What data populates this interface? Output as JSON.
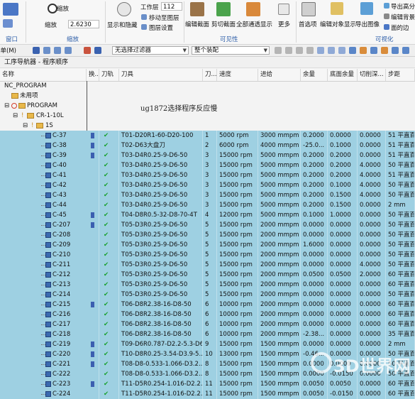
{
  "ribbon": {
    "zoom_label": "缩放",
    "zoom_field_label": "缩放",
    "zoom_value": "2.6230",
    "layer_label": "工作层",
    "layer_value": "112",
    "show_hide": "显示和隐藏",
    "move_to_layer": "移动至图层",
    "layer_settings": "图层设置",
    "edit_section": "编辑截面",
    "cut_section": "剪切截面",
    "show_all": "全部通透显示",
    "more": "更多",
    "preferences": "首选项",
    "edit_object_display": "编辑对象显示",
    "export_image": "导出图像",
    "export_hd": "导出高分",
    "edit_background": "编辑背景",
    "face_edges": "面的边",
    "group_window": "窗口",
    "group_zoom": "缩放",
    "group_visibility": "可见性",
    "group_visualize": "可视化"
  },
  "toolbar": {
    "menu_label": "菜单(M)",
    "filter": "无选择过滤器",
    "assembly": "整个装配"
  },
  "navigator": {
    "title": "工序导航器 - 程序顺序"
  },
  "columns": [
    "名称",
    "换...",
    "刀轨",
    "刀具",
    "刀...",
    "速度",
    "进给",
    "余量",
    "底面余量",
    "切削深...",
    "步距"
  ],
  "tree": {
    "root": "NC_PROGRAM",
    "unused": "未用项",
    "program": "PROGRAM",
    "group": "CR-1-10L",
    "sub": "1S"
  },
  "annotation": "ug1872选择程序反应慢",
  "rows": [
    {
      "name": "C-37",
      "tool": "T01-D20R1-60-D20-100",
      "num": "1",
      "speed": "5000 rpm",
      "feed": "3000 mmpm",
      "stock": "0.2000",
      "floor": "0.0000",
      "depth": "0.0000",
      "step": "51 平直百",
      "gear": true
    },
    {
      "name": "C-38",
      "tool": "T02-D63大盘刀",
      "num": "2",
      "speed": "6000 rpm",
      "feed": "4000 mmpm",
      "stock": "-25.0...",
      "floor": "0.1000",
      "depth": "0.0000",
      "step": "51 平直百",
      "gear": true
    },
    {
      "name": "C-39",
      "tool": "T03-D4R0.25-9-D6-50",
      "num": "3",
      "speed": "15000 rpm",
      "feed": "5000 mmpm",
      "stock": "0.2000",
      "floor": "0.2000",
      "depth": "0.0000",
      "step": "51 平直百",
      "gear": true
    },
    {
      "name": "C-40",
      "tool": "T03-D4R0.25-9-D6-50",
      "num": "3",
      "speed": "15000 rpm",
      "feed": "5000 mmpm",
      "stock": "0.2000",
      "floor": "0.2000",
      "depth": "4.0000",
      "step": "50 平直百",
      "gear": false
    },
    {
      "name": "C-41",
      "tool": "T03-D4R0.25-9-D6-50",
      "num": "3",
      "speed": "15000 rpm",
      "feed": "5000 mmpm",
      "stock": "0.2000",
      "floor": "0.2000",
      "depth": "4.0000",
      "step": "51 平直百",
      "gear": false
    },
    {
      "name": "C-42",
      "tool": "T03-D4R0.25-9-D6-50",
      "num": "3",
      "speed": "15000 rpm",
      "feed": "5000 mmpm",
      "stock": "0.2000",
      "floor": "0.1000",
      "depth": "4.0000",
      "step": "50 平直百",
      "gear": false
    },
    {
      "name": "C-43",
      "tool": "T03-D4R0.25-9-D6-50",
      "num": "3",
      "speed": "15000 rpm",
      "feed": "5000 mmpm",
      "stock": "0.2000",
      "floor": "0.1500",
      "depth": "4.0000",
      "step": "50 平直百",
      "gear": false
    },
    {
      "name": "C-44",
      "tool": "T03-D4R0.25-9-D6-50",
      "num": "3",
      "speed": "15000 rpm",
      "feed": "5000 mmpm",
      "stock": "0.2000",
      "floor": "0.1500",
      "depth": "0.0000",
      "step": "2 mm",
      "gear": false
    },
    {
      "name": "C-45",
      "tool": "T04-D8R0.5-32-D8-70-4T",
      "num": "4",
      "speed": "12000 rpm",
      "feed": "5000 mmpm",
      "stock": "0.1000",
      "floor": "1.0000",
      "depth": "0.0000",
      "step": "50 平直百",
      "gear": true
    },
    {
      "name": "C-207",
      "tool": "T05-D3R0.25-9-D6-50",
      "num": "5",
      "speed": "15000 rpm",
      "feed": "2000 mmpm",
      "stock": "0.0000",
      "floor": "0.0000",
      "depth": "0.0000",
      "step": "50 平直百",
      "gear": true
    },
    {
      "name": "C-208",
      "tool": "T05-D3R0.25-9-D6-50",
      "num": "5",
      "speed": "15000 rpm",
      "feed": "2000 mmpm",
      "stock": "0.0000",
      "floor": "0.0000",
      "depth": "0.0000",
      "step": "50 平直百",
      "gear": false
    },
    {
      "name": "C-209",
      "tool": "T05-D3R0.25-9-D6-50",
      "num": "5",
      "speed": "15000 rpm",
      "feed": "2000 mmpm",
      "stock": "1.6000",
      "floor": "0.0000",
      "depth": "0.0000",
      "step": "50 平直百",
      "gear": false
    },
    {
      "name": "C-210",
      "tool": "T05-D3R0.25-9-D6-50",
      "num": "5",
      "speed": "15000 rpm",
      "feed": "2000 mmpm",
      "stock": "0.0000",
      "floor": "0.0000",
      "depth": "0.0000",
      "step": "50 平直百",
      "gear": false
    },
    {
      "name": "C-211",
      "tool": "T05-D3R0.25-9-D6-50",
      "num": "5",
      "speed": "15000 rpm",
      "feed": "2000 mmpm",
      "stock": "0.0000",
      "floor": "0.0000",
      "depth": "4.0000",
      "step": "50 平直百",
      "gear": false
    },
    {
      "name": "C-212",
      "tool": "T05-D3R0.25-9-D6-50",
      "num": "5",
      "speed": "15000 rpm",
      "feed": "2000 mmpm",
      "stock": "0.0500",
      "floor": "0.0500",
      "depth": "2.0000",
      "step": "60 平直百",
      "gear": false
    },
    {
      "name": "C-213",
      "tool": "T05-D3R0.25-9-D6-50",
      "num": "5",
      "speed": "15000 rpm",
      "feed": "2000 mmpm",
      "stock": "0.0000",
      "floor": "0.0000",
      "depth": "0.0000",
      "step": "60 平直百",
      "gear": false
    },
    {
      "name": "C-214",
      "tool": "T05-D3R0.25-9-D6-50",
      "num": "5",
      "speed": "15000 rpm",
      "feed": "2000 mmpm",
      "stock": "0.0000",
      "floor": "0.0000",
      "depth": "0.0000",
      "step": "50 平直百",
      "gear": false
    },
    {
      "name": "C-215",
      "tool": "T06-D8R2.38-16-D8-50",
      "num": "6",
      "speed": "10000 rpm",
      "feed": "2000 mmpm",
      "stock": "0.0000",
      "floor": "0.0000",
      "depth": "0.0000",
      "step": "60 平直百",
      "gear": true
    },
    {
      "name": "C-216",
      "tool": "T06-D8R2.38-16-D8-50",
      "num": "6",
      "speed": "10000 rpm",
      "feed": "2000 mmpm",
      "stock": "0.0000",
      "floor": "0.0000",
      "depth": "0.0000",
      "step": "60 平直百",
      "gear": false
    },
    {
      "name": "C-217",
      "tool": "T06-D8R2.38-16-D8-50",
      "num": "6",
      "speed": "10000 rpm",
      "feed": "2000 mmpm",
      "stock": "0.0000",
      "floor": "0.0000",
      "depth": "0.0000",
      "step": "60 平直百",
      "gear": false
    },
    {
      "name": "C-218",
      "tool": "T06-D8R2.38-16-D8-50",
      "num": "6",
      "speed": "10000 rpm",
      "feed": "2000 mmpm",
      "stock": "-2.38...",
      "floor": "0.0000",
      "depth": "0.0000",
      "step": "35 平直百",
      "gear": false
    },
    {
      "name": "C-219",
      "tool": "T09-D6R0.787-D2.2-5.3-D6",
      "num": "9",
      "speed": "15000 rpm",
      "feed": "1500 mmpm",
      "stock": "0.0000",
      "floor": "0.0000",
      "depth": "0.0000",
      "step": "2 mm",
      "gear": true
    },
    {
      "name": "C-220",
      "tool": "T10-D8R0.25-3.54-D3.9-5...",
      "num": "10",
      "speed": "13000 rpm",
      "feed": "1500 mmpm",
      "stock": "-0.46...",
      "floor": "0.0000",
      "depth": "0.0000",
      "step": "50 平直百",
      "gear": true
    },
    {
      "name": "C-221",
      "tool": "T08-D8-0.533-1.066-D3.2...",
      "num": "8",
      "speed": "15000 rpm",
      "feed": "1500 mmpm",
      "stock": "0.0000",
      "floor": "0.0000",
      "depth": "0.0000",
      "step": "50 平直百",
      "gear": true
    },
    {
      "name": "C-222",
      "tool": "T08-D8-0.533-1.066-D3.2...",
      "num": "8",
      "speed": "15000 rpm",
      "feed": "1500 mmpm",
      "stock": "0.0000",
      "floor": "-0.0150",
      "depth": "0.0000",
      "step": "50 平直百",
      "gear": false
    },
    {
      "name": "C-223",
      "tool": "T11-D5R0.254-1.016-D2.2...",
      "num": "11",
      "speed": "15000 rpm",
      "feed": "1500 mmpm",
      "stock": "0.0050",
      "floor": "0.0050",
      "depth": "0.0000",
      "step": "60 平直百",
      "gear": true
    },
    {
      "name": "C-224",
      "tool": "T11-D5R0.254-1.016-D2.2...",
      "num": "11",
      "speed": "15000 rpm",
      "feed": "1500 mmpm",
      "stock": "0.0050",
      "floor": "-0.0150",
      "depth": "0.0000",
      "step": "60 平直百",
      "gear": false
    }
  ],
  "watermark": "3D世界网",
  "colors": {
    "selection": "#9ed0e2",
    "check": "#19a12d",
    "tool_icon": "#3b6ab0",
    "folder": "#e8b84a",
    "stop": "#d43b2a"
  }
}
